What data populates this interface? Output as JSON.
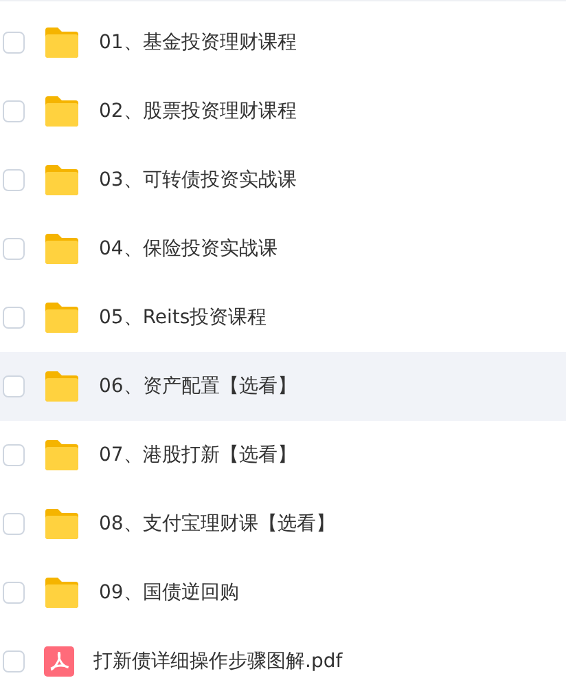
{
  "files": [
    {
      "name": "01、基金投资理财课程",
      "kind": "folder",
      "checked": false,
      "hovered": false
    },
    {
      "name": "02、股票投资理财课程",
      "kind": "folder",
      "checked": false,
      "hovered": false
    },
    {
      "name": "03、可转债投资实战课",
      "kind": "folder",
      "checked": false,
      "hovered": false
    },
    {
      "name": "04、保险投资实战课",
      "kind": "folder",
      "checked": false,
      "hovered": false
    },
    {
      "name": "05、Reits投资课程",
      "kind": "folder",
      "checked": false,
      "hovered": false
    },
    {
      "name": "06、资产配置【选看】",
      "kind": "folder",
      "checked": false,
      "hovered": true
    },
    {
      "name": "07、港股打新【选看】",
      "kind": "folder",
      "checked": false,
      "hovered": false
    },
    {
      "name": "08、支付宝理财课【选看】",
      "kind": "folder",
      "checked": false,
      "hovered": false
    },
    {
      "name": "09、国债逆回购",
      "kind": "folder",
      "checked": false,
      "hovered": false
    },
    {
      "name": "打新债详细操作步骤图解.pdf",
      "kind": "pdf",
      "checked": false,
      "hovered": false
    }
  ]
}
